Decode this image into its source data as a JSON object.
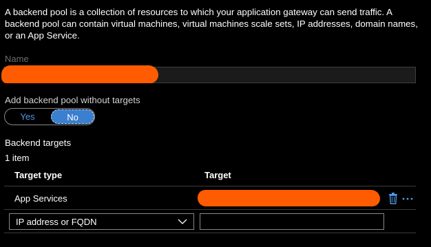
{
  "description": "A backend pool is a collection of resources to which your application gateway can send traffic. A backend pool can contain virtual machines, virtual machines scale sets, IP addresses, domain names, or an App Service.",
  "name_field": {
    "label": "Name",
    "value": ""
  },
  "without_targets": {
    "label": "Add backend pool without targets",
    "options": [
      "Yes",
      "No"
    ],
    "selected": "No"
  },
  "backend_targets": {
    "title": "Backend targets",
    "count": "1 item",
    "columns": [
      "Target type",
      "Target"
    ],
    "rows": [
      {
        "type": "App Services",
        "target": ""
      }
    ],
    "new_row": {
      "type_value": "IP address or FQDN",
      "target_value": ""
    }
  },
  "colors": {
    "accent": "#4d9be8",
    "toggle_selected_bg": "#3b7fcf",
    "redaction": "#ff5b00",
    "background": "#000000"
  },
  "icons": {
    "delete": "trash-icon",
    "more": "ellipsis-icon",
    "dropdown": "chevron-down-icon"
  }
}
